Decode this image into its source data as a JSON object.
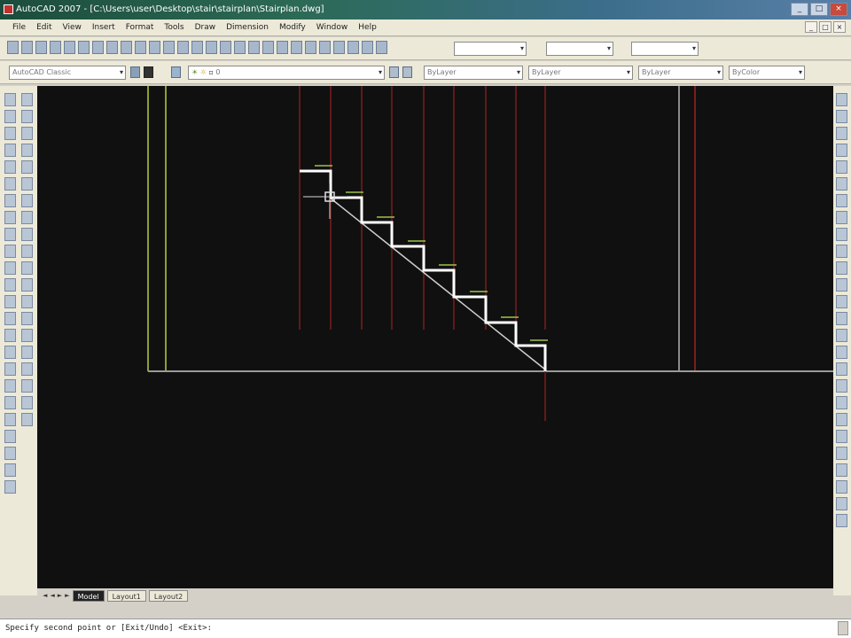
{
  "window": {
    "title": "AutoCAD 2007 - [C:\\Users\\user\\Desktop\\stair\\stairplan\\Stairplan.dwg]",
    "controls": [
      "_",
      "□",
      "×"
    ]
  },
  "menu": {
    "items": [
      "File",
      "Edit",
      "View",
      "Insert",
      "Format",
      "Tools",
      "Draw",
      "Dimension",
      "Modify",
      "Window",
      "Help"
    ],
    "mdi_controls": [
      "_",
      "□",
      "×"
    ]
  },
  "toolbars": {
    "style_combo": "",
    "dim_combo": "",
    "workspace_combo": "AutoCAD Classic",
    "layer_combo": "0",
    "color_combo": "ByLayer",
    "linetype_combo": "ByLayer",
    "lineweight_combo": "ByLayer",
    "plotstyle_combo": "ByColor"
  },
  "tabs": {
    "nav": [
      "◄",
      "◄",
      "►",
      "►"
    ],
    "items": [
      "Model",
      "Layout1",
      "Layout2"
    ],
    "active": "Model"
  },
  "command_line": {
    "prompt": "Specify second point or [Exit/Undo] <Exit>:"
  },
  "colors": {
    "canvas_bg": "#101010",
    "stair_line": "#ffffff",
    "guide_red": "#7a1e1a",
    "guide_green": "#8aa030",
    "ground_line": "#9a9a9a",
    "dim_text": "#9cc24a"
  }
}
